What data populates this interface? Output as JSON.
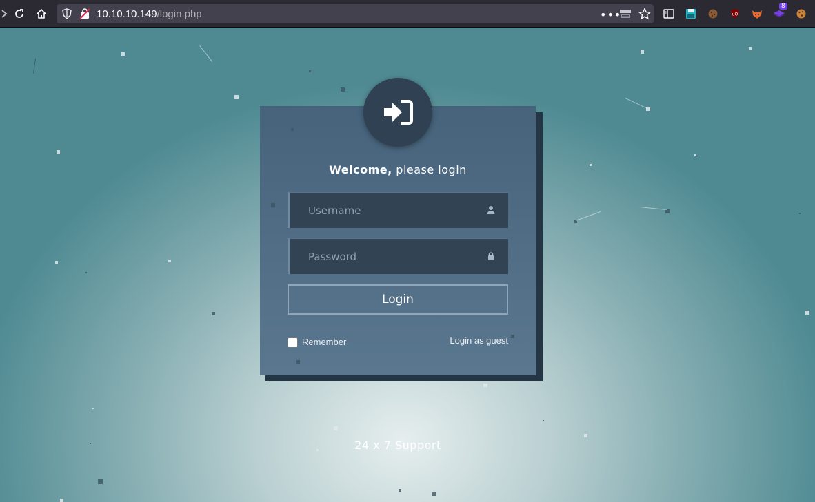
{
  "browser": {
    "url_host": "10.10.10.149",
    "url_path": "/login.php",
    "extension_badge": "8"
  },
  "login": {
    "welcome_bold": "Welcome,",
    "welcome_rest": " please login",
    "username_placeholder": "Username",
    "password_placeholder": "Password",
    "login_button": "Login",
    "remember_label": "Remember",
    "guest_link": "Login as guest"
  },
  "footer": {
    "support_text": "24 x 7 Support"
  },
  "colors": {
    "card": "#4f6b83",
    "badge_bg": "#2f4152",
    "toolbar": "#2b2a33",
    "urlbar": "#42414d"
  }
}
